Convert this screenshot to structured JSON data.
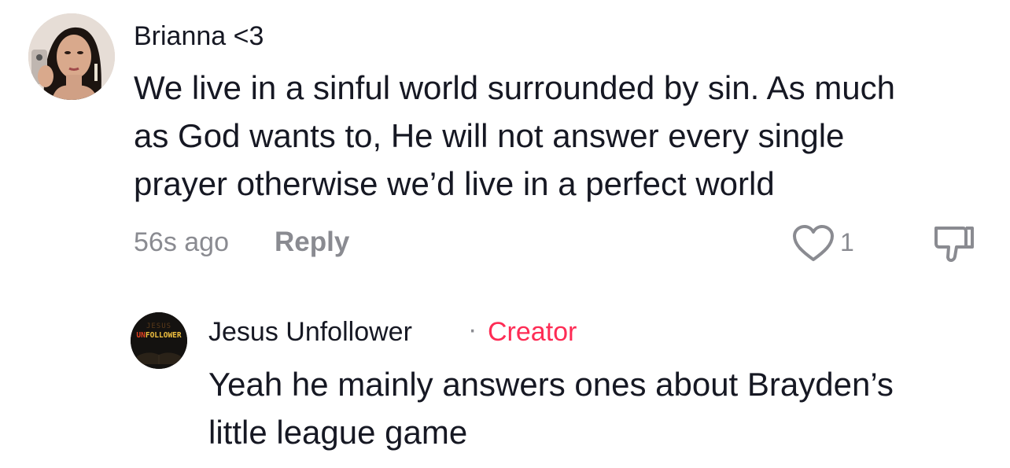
{
  "comment": {
    "username": "Brianna <3",
    "text_lines": [
      "We live in a sinful world surrounded by sin. As much",
      "as God wants to, He will not answer every single",
      "prayer otherwise we’d live in a perfect world"
    ],
    "timestamp": "56s ago",
    "reply_label": "Reply",
    "like_count": "1",
    "like_icon": "heart-outline-icon",
    "dislike_icon": "thumbs-down-outline-icon"
  },
  "reply": {
    "username": "Jesus Unfollower",
    "separator": "·",
    "badge": "Creator",
    "text_lines": [
      "Yeah he mainly answers ones about Brayden’s",
      "little league game"
    ],
    "avatar_logo": {
      "top": "JESUS",
      "un": "UN",
      "rest": "FOLLOWER"
    }
  },
  "colors": {
    "text": "#161823",
    "meta": "#8a8b91",
    "creator": "#fe2c55",
    "background": "#ffffff"
  }
}
